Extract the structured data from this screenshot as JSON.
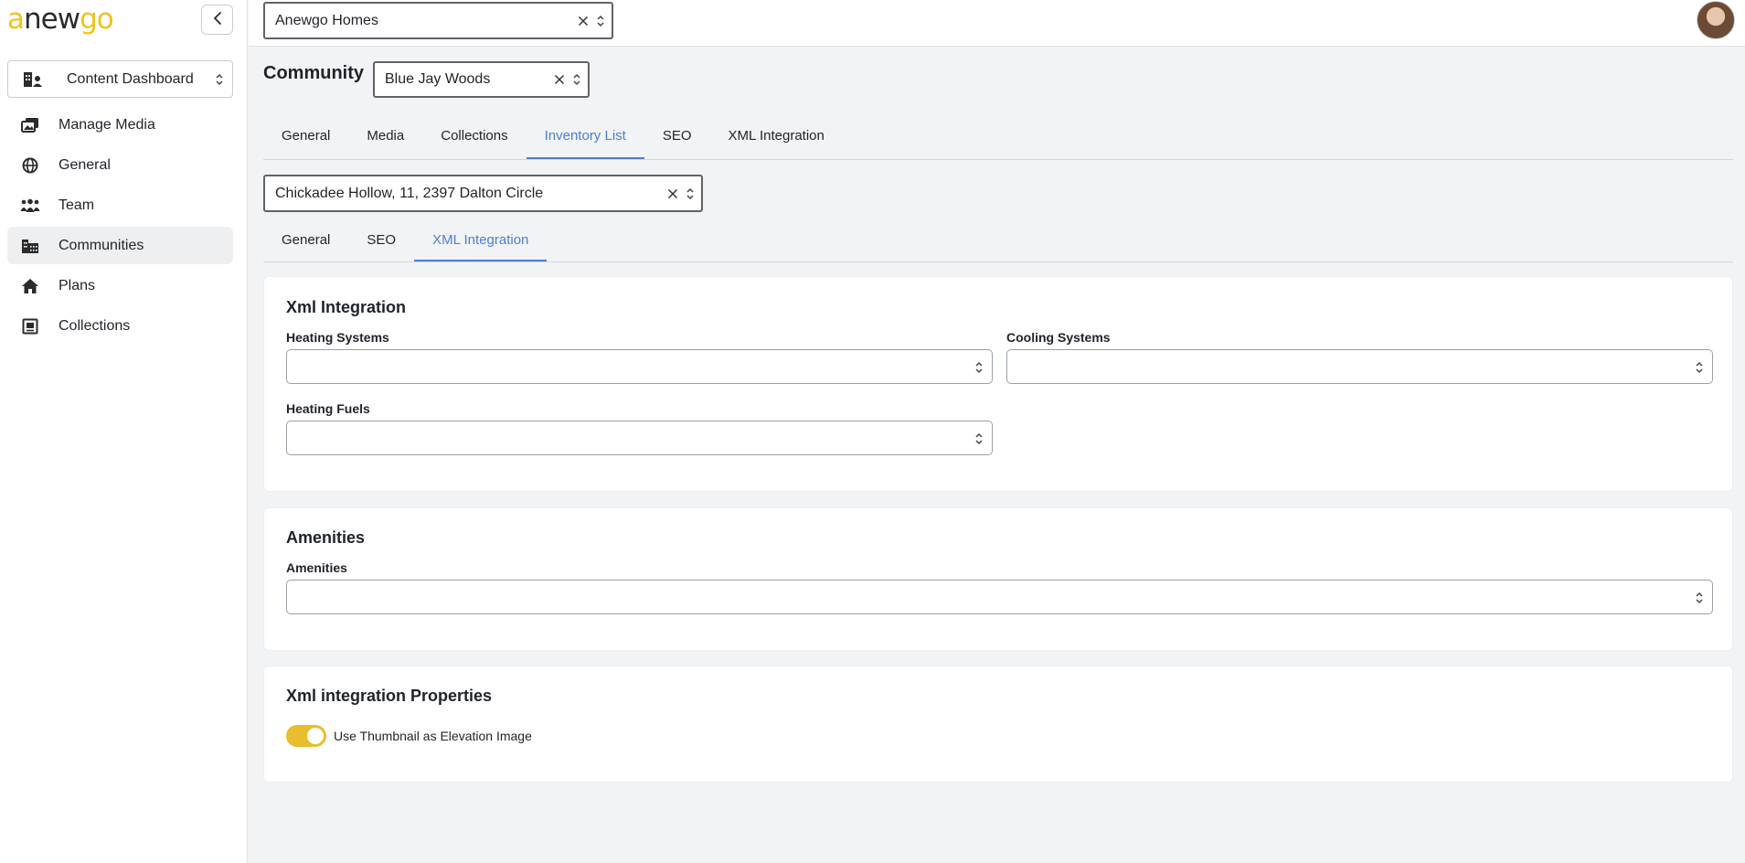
{
  "brand": {
    "logo_part1": "a",
    "logo_part2": "new",
    "logo_part3": "go",
    "accent": "#f2c21b"
  },
  "sidebar": {
    "dashboard_select": {
      "label": "Content Dashboard",
      "icon": "building-user-icon"
    },
    "items": [
      {
        "label": "Manage Media",
        "icon": "images-icon",
        "active": false
      },
      {
        "label": "General",
        "icon": "globe-icon",
        "active": false
      },
      {
        "label": "Team",
        "icon": "people-group-icon",
        "active": false
      },
      {
        "label": "Communities",
        "icon": "city-icon",
        "active": true
      },
      {
        "label": "Plans",
        "icon": "home-icon",
        "active": false
      },
      {
        "label": "Collections",
        "icon": "collection-icon",
        "active": false
      }
    ]
  },
  "topbar": {
    "org_select_value": "Anewgo Homes"
  },
  "main": {
    "community_label": "Community",
    "community_value": "Blue Jay Woods",
    "tabs": [
      {
        "label": "General"
      },
      {
        "label": "Media"
      },
      {
        "label": "Collections"
      },
      {
        "label": "Inventory List",
        "active": true
      },
      {
        "label": "SEO"
      },
      {
        "label": "XML Integration"
      }
    ],
    "lot_value": "Chickadee Hollow, 11, 2397 Dalton Circle",
    "sub_tabs": [
      {
        "label": "General"
      },
      {
        "label": "SEO"
      },
      {
        "label": "XML Integration",
        "active": true
      }
    ],
    "xml_card": {
      "title": "Xml Integration",
      "heating_systems_label": "Heating Systems",
      "cooling_systems_label": "Cooling Systems",
      "heating_fuels_label": "Heating Fuels"
    },
    "amenities_card": {
      "title": "Amenities",
      "amenities_label": "Amenities"
    },
    "properties_card": {
      "title": "Xml integration Properties",
      "toggle_label": "Use Thumbnail as Elevation Image",
      "toggle_on": true
    }
  },
  "colors": {
    "tab_active": "#4a7fd4",
    "toggle_on": "#e8bd2e"
  }
}
